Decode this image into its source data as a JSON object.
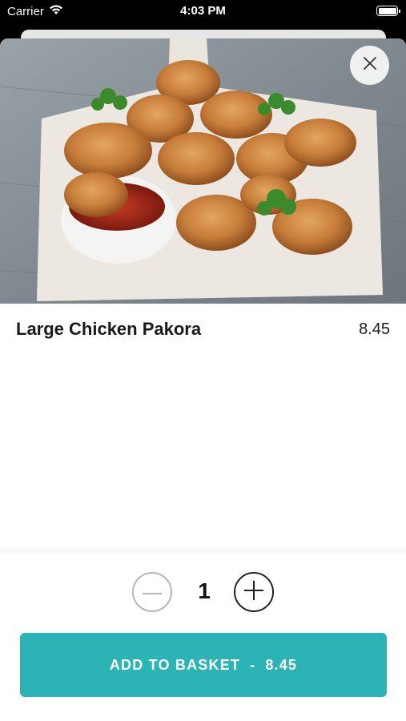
{
  "status_bar": {
    "carrier": "Carrier",
    "time": "4:03 PM",
    "icons": [
      "wifi-icon",
      "battery-icon"
    ]
  },
  "product": {
    "name": "Large Chicken Pakora",
    "price": "8.45",
    "image_icon": "food-photo"
  },
  "close_icon": "close-icon",
  "quantity": {
    "value": "1",
    "minus_icon": "minus-icon",
    "plus_icon": "plus-icon"
  },
  "add_button": {
    "label": "ADD TO BASKET",
    "separator": "-",
    "price": "8.45"
  },
  "colors": {
    "accent": "#2cb3b6",
    "text": "#1a1a1a"
  }
}
